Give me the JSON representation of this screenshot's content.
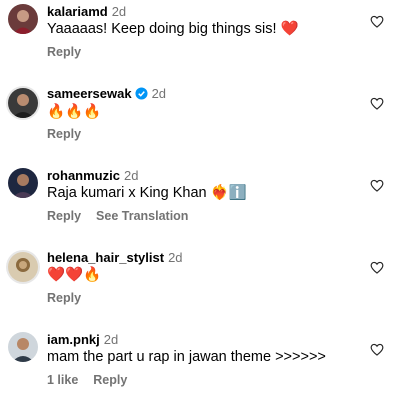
{
  "comments": [
    {
      "username": "kalariamd",
      "time": "2d",
      "verified": false,
      "text": "Yaaaaas! Keep doing big things sis! ❤️",
      "actions": [
        "Reply"
      ]
    },
    {
      "username": "sameersewak",
      "time": "2d",
      "verified": true,
      "text": "🔥🔥🔥",
      "actions": [
        "Reply"
      ]
    },
    {
      "username": "rohanmuzic",
      "time": "2d",
      "verified": false,
      "text": "Raja kumari x King Khan ❤️‍🔥ℹ️",
      "actions": [
        "Reply",
        "See Translation"
      ]
    },
    {
      "username": "helena_hair_stylist",
      "time": "2d",
      "verified": false,
      "text": "❤️❤️🔥",
      "actions": [
        "Reply"
      ]
    },
    {
      "username": "iam.pnkj",
      "time": "2d",
      "verified": false,
      "text": "mam the part u rap in jawan theme >>>>>>",
      "actions": [
        "1 like",
        "Reply"
      ]
    }
  ],
  "icons": {
    "like": "heart-outline-icon",
    "verified": "verified-badge-icon"
  },
  "colors": {
    "secondary_text": "#737373",
    "verified_blue": "#0095f6"
  }
}
